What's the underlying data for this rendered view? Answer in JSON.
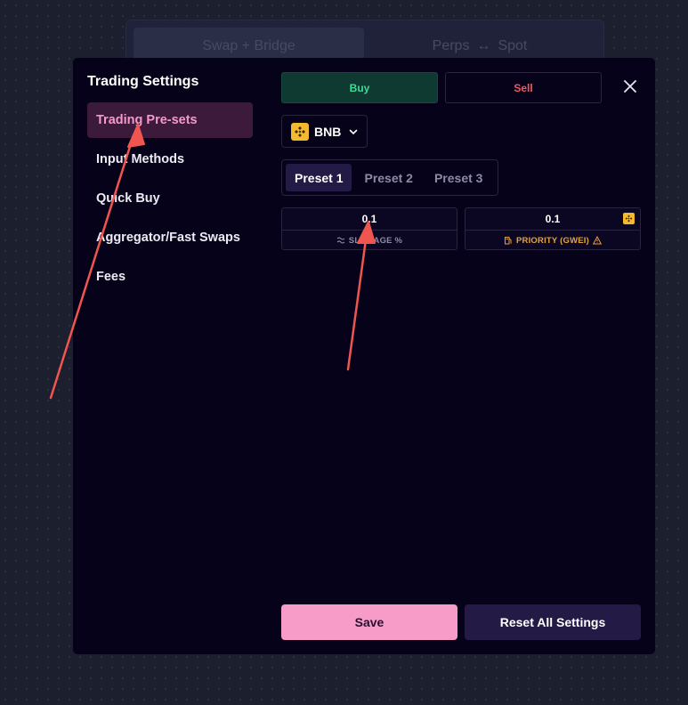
{
  "background": {
    "tabs": [
      {
        "label": "Swap + Bridge"
      },
      {
        "label": "Perps",
        "icon": "swap-arrows-icon",
        "label2": "Spot"
      }
    ]
  },
  "modal": {
    "title": "Trading Settings",
    "nav": [
      {
        "label": "Trading Pre-sets",
        "active": true
      },
      {
        "label": "Input Methods"
      },
      {
        "label": "Quick Buy"
      },
      {
        "label": "Aggregator/Fast Swaps"
      },
      {
        "label": "Fees"
      }
    ],
    "trade_type": {
      "buy_label": "Buy",
      "sell_label": "Sell",
      "selected": "Buy"
    },
    "chain": {
      "symbol": "BNB",
      "icon": "bnb-icon",
      "color": "#f3ba2f"
    },
    "presets": [
      {
        "label": "Preset 1",
        "active": true
      },
      {
        "label": "Preset 2"
      },
      {
        "label": "Preset 3"
      }
    ],
    "slippage": {
      "value": "0.1",
      "label": "SLIPPAGE %",
      "icon": "slippage-icon"
    },
    "priority": {
      "value": "0.1",
      "label": "PRIORITY (GWEI)",
      "icon": "gas-pump-icon",
      "warning_icon": "warning-icon",
      "color": "#e9a23b"
    },
    "save_label": "Save",
    "reset_label": "Reset All Settings"
  },
  "colors": {
    "accent_pink": "#f79bc8",
    "buy_green": "#3fdb94",
    "sell_red": "#f0595c",
    "annotation_arrow": "#f0554f"
  }
}
